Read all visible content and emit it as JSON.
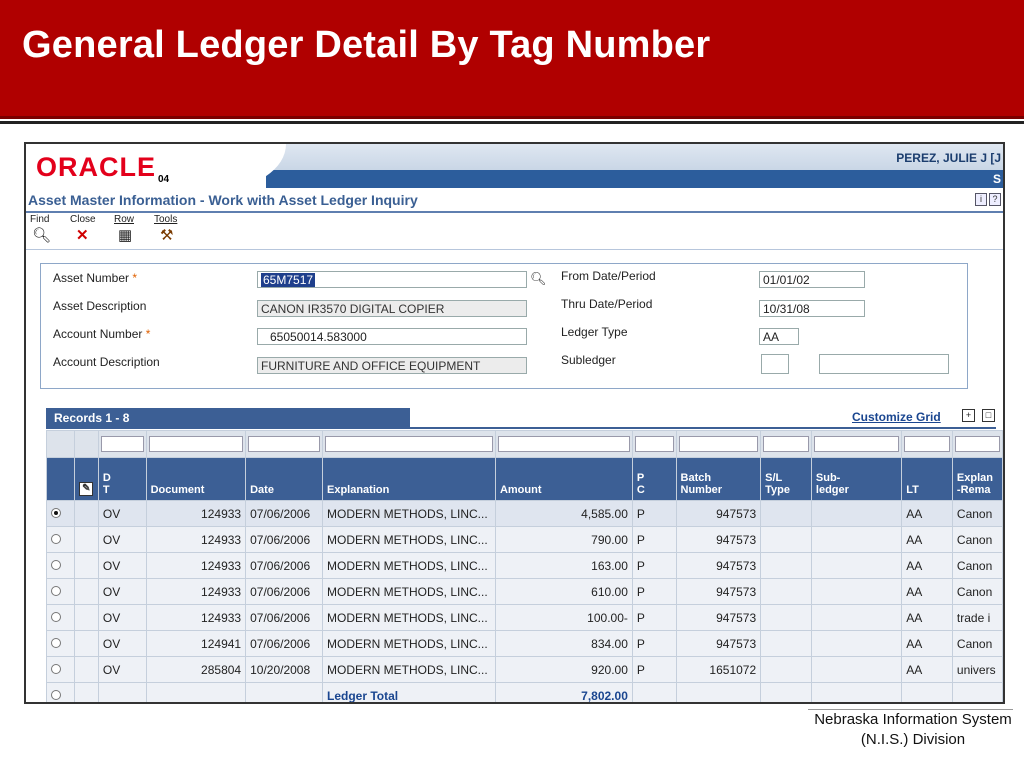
{
  "slide": {
    "title": "General Ledger Detail By Tag Number"
  },
  "header": {
    "logo": "ORACLE",
    "version": "04",
    "user": "PEREZ, JULIE J  [J",
    "user_line2": "S"
  },
  "app": {
    "title": "Asset Master Information - Work with Asset Ledger Inquiry"
  },
  "menu": [
    {
      "label": "Find",
      "icon": "find-icon"
    },
    {
      "label": "Close",
      "icon": "close-icon"
    },
    {
      "label": "Row",
      "icon": "row-icon"
    },
    {
      "label": "Tools",
      "icon": "tools-icon"
    }
  ],
  "form": {
    "asset_number_label": "Asset Number",
    "asset_number": "65M7517",
    "asset_description_label": "Asset Description",
    "asset_description": "CANON IR3570 DIGITAL COPIER",
    "account_number_label": "Account Number",
    "account_number": "65050014.583000",
    "account_description_label": "Account Description",
    "account_description": "FURNITURE AND OFFICE EQUIPMENT",
    "from_date_label": "From Date/Period",
    "from_date": "01/01/02",
    "thru_date_label": "Thru Date/Period",
    "thru_date": "10/31/08",
    "ledger_type_label": "Ledger Type",
    "ledger_type": "AA",
    "subledger_label": "Subledger",
    "subledger": "",
    "subledger_type": "",
    "required_mark": "*"
  },
  "grid": {
    "records_label": "Records 1 - 8",
    "customize_label": "Customize Grid",
    "columns": [
      "D\nT",
      "Document",
      "Date",
      "Explanation",
      "Amount",
      "P\nC",
      "Batch\nNumber",
      "S/L\nType",
      "Sub-\nledger",
      "LT",
      "Explan\n-Rema"
    ],
    "rows": [
      {
        "selected": true,
        "dt": "OV",
        "document": "124933",
        "date": "07/06/2006",
        "explanation": "MODERN METHODS, LINC...",
        "amount": "4,585.00",
        "pc": "P",
        "batch": "947573",
        "sl_type": "",
        "subledger": "",
        "lt": "AA",
        "remark": "Canon"
      },
      {
        "selected": false,
        "dt": "OV",
        "document": "124933",
        "date": "07/06/2006",
        "explanation": "MODERN METHODS, LINC...",
        "amount": "790.00",
        "pc": "P",
        "batch": "947573",
        "sl_type": "",
        "subledger": "",
        "lt": "AA",
        "remark": "Canon"
      },
      {
        "selected": false,
        "dt": "OV",
        "document": "124933",
        "date": "07/06/2006",
        "explanation": "MODERN METHODS, LINC...",
        "amount": "163.00",
        "pc": "P",
        "batch": "947573",
        "sl_type": "",
        "subledger": "",
        "lt": "AA",
        "remark": "Canon"
      },
      {
        "selected": false,
        "dt": "OV",
        "document": "124933",
        "date": "07/06/2006",
        "explanation": "MODERN METHODS, LINC...",
        "amount": "610.00",
        "pc": "P",
        "batch": "947573",
        "sl_type": "",
        "subledger": "",
        "lt": "AA",
        "remark": "Canon"
      },
      {
        "selected": false,
        "dt": "OV",
        "document": "124933",
        "date": "07/06/2006",
        "explanation": "MODERN METHODS, LINC...",
        "amount": "100.00-",
        "pc": "P",
        "batch": "947573",
        "sl_type": "",
        "subledger": "",
        "lt": "AA",
        "remark": "trade i"
      },
      {
        "selected": false,
        "dt": "OV",
        "document": "124941",
        "date": "07/06/2006",
        "explanation": "MODERN METHODS, LINC...",
        "amount": "834.00",
        "pc": "P",
        "batch": "947573",
        "sl_type": "",
        "subledger": "",
        "lt": "AA",
        "remark": "Canon"
      },
      {
        "selected": false,
        "dt": "OV",
        "document": "285804",
        "date": "10/20/2008",
        "explanation": "MODERN METHODS, LINC...",
        "amount": "920.00",
        "pc": "P",
        "batch": "1651072",
        "sl_type": "",
        "subledger": "",
        "lt": "AA",
        "remark": "univers"
      }
    ],
    "total": {
      "label": "Ledger Total",
      "amount": "7,802.00"
    }
  },
  "footer": {
    "line1": "Nebraska Information System",
    "line2": "(N.I.S.) Division"
  },
  "colors": {
    "banner": "#b00000",
    "grid_header": "#3c5f95",
    "oracle_red": "#e3001b",
    "link": "#1a4690"
  }
}
